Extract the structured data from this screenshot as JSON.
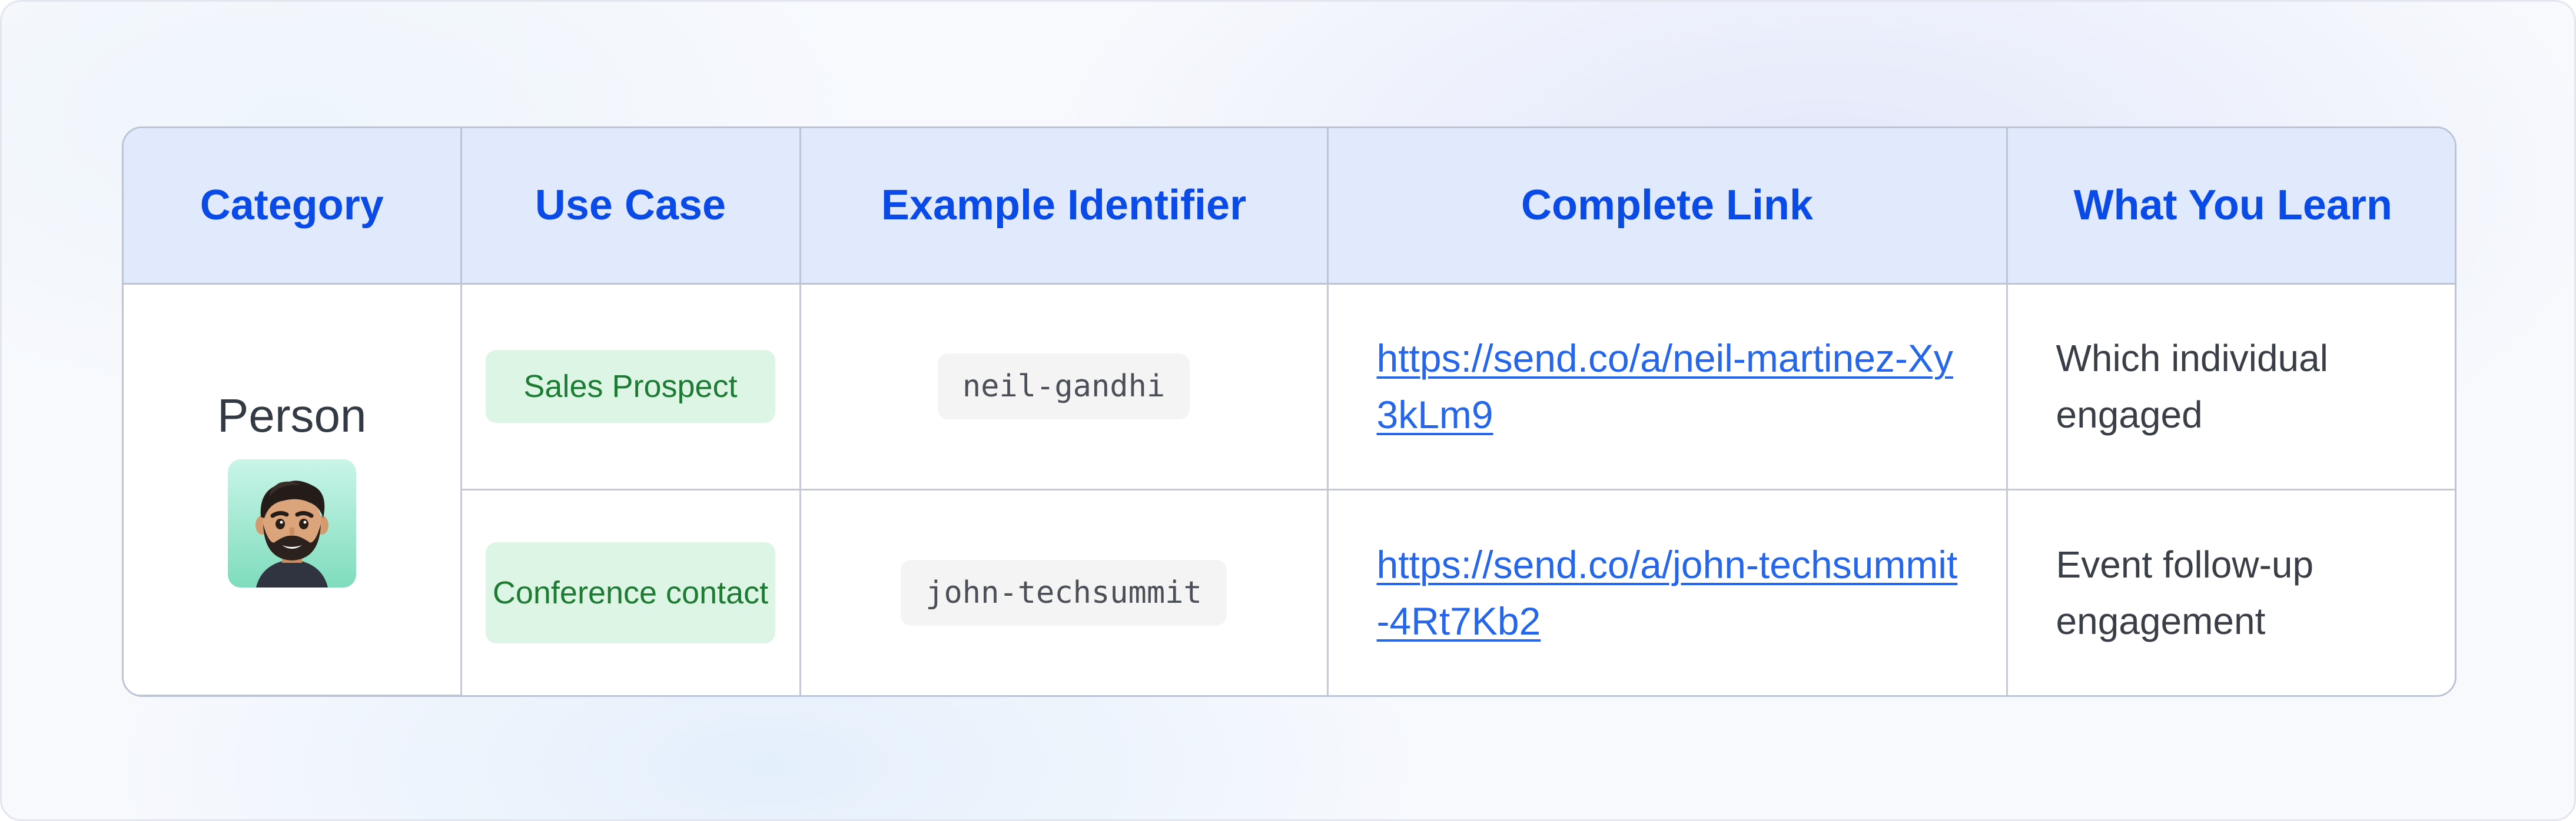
{
  "table": {
    "headers": [
      "Category",
      "Use Case",
      "Example Identifier",
      "Complete Link",
      "What You Learn"
    ],
    "category": {
      "label": "Person",
      "icon": "person-memoji-icon"
    },
    "rows": [
      {
        "use_case": "Sales Prospect",
        "identifier": "neil-gandhi",
        "link": "https://send.co/a/neil-martinez-Xy3kLm9",
        "learn": "Which individual engaged"
      },
      {
        "use_case": "Conference contact",
        "identifier": "john-techsummit",
        "link": "https://send.co/a/john-techsummit-4Rt7Kb2",
        "learn": "Event follow-up engagement"
      }
    ]
  },
  "colors": {
    "header_background": "#e1eafc",
    "header_text": "#0a4be8",
    "pill_background": "#ddf5e4",
    "pill_text": "#1e7b34",
    "link": "#2566ea"
  }
}
